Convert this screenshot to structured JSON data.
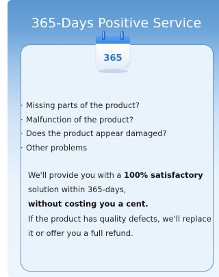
{
  "header": {
    "title": "365-Days Positive Service"
  },
  "calendar": {
    "label": "365"
  },
  "issues": [
    "Missing parts of the product?",
    "Malfunction of the product?",
    "Does the product appear damaged?",
    "Other problems"
  ],
  "bullet": "·",
  "guarantee": {
    "line1_prefix": "We'll provide you with a ",
    "line1_bold": "100% satisfactory",
    "line2": "solution within 365-days,",
    "line3_bold": "without costing you a cent.",
    "line4": "If the product has quality defects, we'll replace",
    "line5": "it or offer you a full refund."
  },
  "colors": {
    "header_blue": "#5d97d0",
    "card_border": "#5b95cf",
    "calendar_blue": "#3f8de8",
    "calendar_text": "#2f6fd0"
  }
}
